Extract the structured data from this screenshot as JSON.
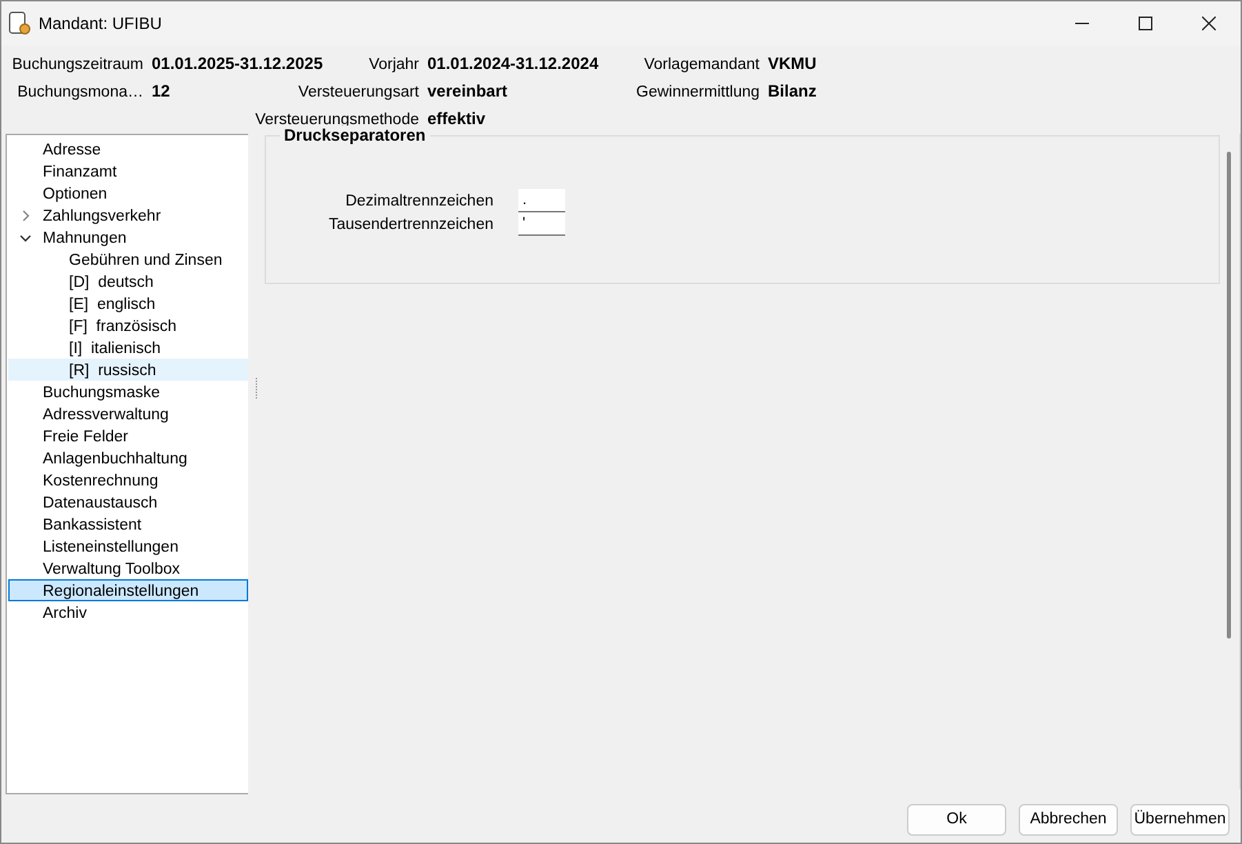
{
  "window": {
    "title": "Mandant: UFIBU"
  },
  "header": {
    "rows": [
      [
        {
          "label": "Buchungszeitraum",
          "value": "01.01.2025-31.12.2025"
        },
        {
          "label": "Vorjahr",
          "value": "01.01.2024-31.12.2024"
        },
        {
          "label": "Vorlagemandant",
          "value": "VKMU"
        }
      ],
      [
        {
          "label": "Buchungsmona…",
          "value": "12"
        },
        {
          "label": "Versteuerungsart",
          "value": "vereinbart"
        },
        {
          "label": "Gewinnermittlung",
          "value": "Bilanz"
        }
      ],
      [
        {
          "label": "Versteuerungsmethode",
          "value": "effektiv"
        }
      ]
    ]
  },
  "sidebar": {
    "items": [
      {
        "label": "Adresse",
        "selected": false,
        "hovered": false
      },
      {
        "label": "Finanzamt",
        "selected": false,
        "hovered": false
      },
      {
        "label": "Optionen",
        "selected": false,
        "hovered": false
      },
      {
        "label": "Zahlungsverkehr",
        "selected": false,
        "hovered": false,
        "expanded": false
      },
      {
        "label": "Mahnungen",
        "selected": false,
        "hovered": false,
        "expanded": true,
        "children": [
          {
            "label": "Gebühren und Zinsen",
            "selected": false,
            "hovered": false
          },
          {
            "label": "[D]  deutsch",
            "selected": false,
            "hovered": false
          },
          {
            "label": "[E]  englisch",
            "selected": false,
            "hovered": false
          },
          {
            "label": "[F]  französisch",
            "selected": false,
            "hovered": false
          },
          {
            "label": "[I]  italienisch",
            "selected": false,
            "hovered": false
          },
          {
            "label": "[R]  russisch",
            "selected": false,
            "hovered": true
          }
        ]
      },
      {
        "label": "Buchungsmaske",
        "selected": false,
        "hovered": false
      },
      {
        "label": "Adressverwaltung",
        "selected": false,
        "hovered": false
      },
      {
        "label": "Freie Felder",
        "selected": false,
        "hovered": false
      },
      {
        "label": "Anlagenbuchhaltung",
        "selected": false,
        "hovered": false
      },
      {
        "label": "Kostenrechnung",
        "selected": false,
        "hovered": false
      },
      {
        "label": "Datenaustausch",
        "selected": false,
        "hovered": false
      },
      {
        "label": "Bankassistent",
        "selected": false,
        "hovered": false
      },
      {
        "label": "Listeneinstellungen",
        "selected": false,
        "hovered": false
      },
      {
        "label": "Verwaltung Toolbox",
        "selected": false,
        "hovered": false
      },
      {
        "label": "Regionaleinstellungen",
        "selected": true,
        "hovered": false
      },
      {
        "label": "Archiv",
        "selected": false,
        "hovered": false
      }
    ]
  },
  "group": {
    "title": "Druckseparatoren",
    "fields": [
      {
        "label": "Dezimaltrennzeichen",
        "value": "."
      },
      {
        "label": "Tausendertrennzeichen",
        "value": "'"
      }
    ]
  },
  "buttons": [
    "Ok",
    "Abbrechen",
    "Übernehmen"
  ]
}
